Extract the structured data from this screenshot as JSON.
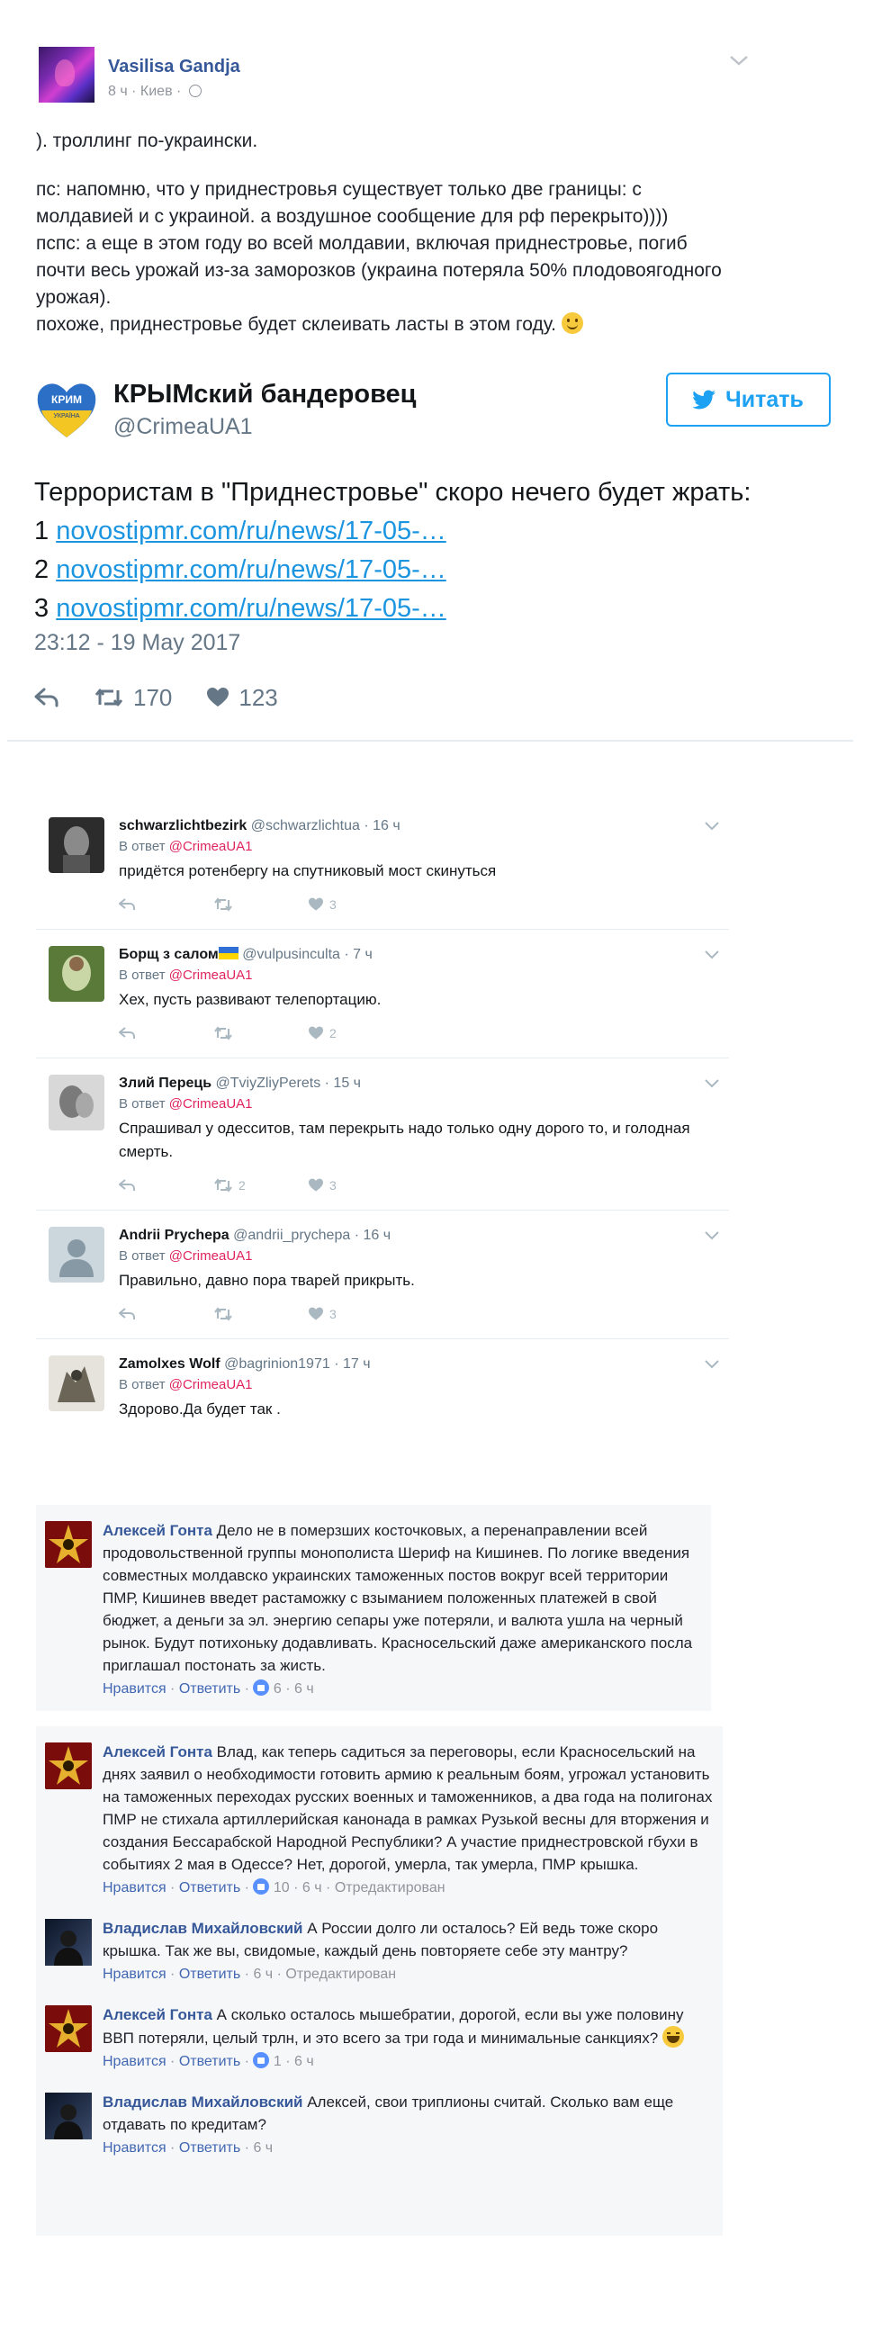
{
  "fb_post": {
    "author": "Vasilisa Gandja",
    "time": "8 ч",
    "location": "Киев",
    "separator": "·",
    "paragraphs": [
      "). троллинг по-украински.",
      "пс: напомню, что у приднестровья существует только две границы: с молдавией и с украиной. а воздушное сообщение для рф перекрыто))))",
      "пспс: а еще в этом году во всей молдавии, включая приднестровье, погиб почти весь урожай из-за заморозков (украина потеряла 50% плодовоягодного урожая).",
      "похоже, приднестровье будет склеивать ласты в этом году."
    ]
  },
  "tweet": {
    "name": "КРЫМский бандеровец",
    "handle": "@CrimeaUA1",
    "follow_label": "Читать",
    "avatar_label": "КРИМ",
    "avatar_sublabel": "УКРАЇНА",
    "text": "Террористам в \"Приднестровье\" скоро нечего будет жрать:",
    "links": [
      {
        "num": "1",
        "url": "novostipmr.com/ru/news/17-05-…"
      },
      {
        "num": "2",
        "url": "novostipmr.com/ru/news/17-05-…"
      },
      {
        "num": "3",
        "url": "novostipmr.com/ru/news/17-05-…"
      }
    ],
    "date": "23:12 - 19 May 2017",
    "retweets": "170",
    "likes": "123"
  },
  "replies": [
    {
      "name": "schwarzlichtbezirk",
      "handle": "@schwarzlichtua",
      "time": "· 16 ч",
      "reply_prefix": "В ответ",
      "reply_to": "@CrimeaUA1",
      "text": "придётся ротенбергу на спутниковый мост скинуться",
      "retweets": "",
      "likes": "3"
    },
    {
      "name": "Борщ з салом",
      "handle": "@vulpusinculta",
      "time": "· 7 ч",
      "reply_prefix": "В ответ",
      "reply_to": "@CrimeaUA1",
      "text": "Хех, пусть развивают телепортацию.",
      "retweets": "",
      "likes": "2"
    },
    {
      "name": "Злий Перець",
      "handle": "@TviyZliyPerets",
      "time": "· 15 ч",
      "reply_prefix": "В ответ",
      "reply_to": "@CrimeaUA1",
      "text": "Спрашивал у одесситов, там перекрыть надо только одну дорого то, и голодная смерть.",
      "retweets": "2",
      "likes": "3"
    },
    {
      "name": "Andrii Prychepa",
      "handle": "@andrii_prychepa",
      "time": "· 16 ч",
      "reply_prefix": "В ответ",
      "reply_to": "@CrimeaUA1",
      "text": "Правильно, давно пора тварей прикрыть.",
      "retweets": "",
      "likes": "3"
    },
    {
      "name": "Zamolxes Wolf",
      "handle": "@bagrinion1971",
      "time": "· 17 ч",
      "reply_prefix": "В ответ",
      "reply_to": "@CrimeaUA1",
      "text": "Здорово.Да будет так ."
    }
  ],
  "comment_a": {
    "author": "Алексей Гонта",
    "text": "Дело не в померзших косточковых, а перенаправлении всей продовольственной группы монополиста Шериф на Кишинев. По логике введения совместных молдавско украинских таможенных постов вокруг всей территории ПМР, Кишинев введет растаможку с взыманием положенных платежей в свой бюджет, а деньги за эл. энергию сепары уже потеряли, и валюта ушла на черный рынок. Будут потихоньку додавливать. Красносельский даже американского посла приглашал постонать за жисть.",
    "like": "Нравится",
    "reply": "Ответить",
    "likes": "6",
    "time": "6 ч"
  },
  "comments_b": [
    {
      "author": "Алексей Гонта",
      "text": "Влад, как теперь садиться за переговоры, если Красносельский на днях заявил о необходимости готовить армию к реальным боям, угрожал установить на таможенных переходах русских военных и таможенников, а два года на полигонах ПМР не стихала артиллерийская канонада в рамках Рузькой весны для вторжения и создания Бессарабской Народной Республики? А участие приднестровской гбухи в событиях 2 мая в Одессе? Нет, дорогой, умерла, так умерла, ПМР крышка.",
      "like": "Нравится",
      "reply": "Ответить",
      "likes": "10",
      "time": "6 ч",
      "edited": "Отредактирован"
    },
    {
      "author": "Владислав Михайловский",
      "text": "А России долго ли осталось? Ей ведь тоже скоро крышка. Так же вы, свидомые, каждый день повторяете себе эту мантру?",
      "like": "Нравится",
      "reply": "Ответить",
      "likes": "",
      "time": "6 ч",
      "edited": "Отредактирован"
    },
    {
      "author": "Алексей Гонта",
      "text": "А сколько осталось мышебратии, дорогой, если вы уже половину ВВП потеряли, целый трлн, и это всего за три года и минимальные санкциях?",
      "like": "Нравится",
      "reply": "Ответить",
      "likes": "1",
      "time": "6 ч",
      "edited": ""
    },
    {
      "author": "Владислав Михайловский",
      "text": "Алексей, свои триплионы считай. Сколько вам еще отдавать по кредитам?",
      "like": "Нравится",
      "reply": "Ответить",
      "likes": "",
      "time": "6 ч",
      "edited": ""
    }
  ]
}
